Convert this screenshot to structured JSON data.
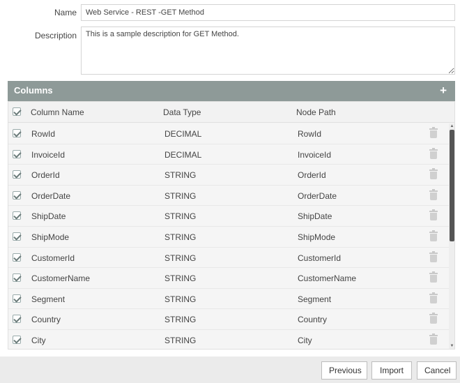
{
  "form": {
    "name_label": "Name",
    "name_value": "Web Service - REST -GET Method",
    "description_label": "Description",
    "description_value": "This is a sample description for GET Method."
  },
  "columns_panel": {
    "title": "Columns",
    "add_icon": "plus-icon"
  },
  "table": {
    "headers": {
      "column_name": "Column Name",
      "data_type": "Data Type",
      "node_path": "Node Path"
    },
    "rows": [
      {
        "name": "RowId",
        "type": "DECIMAL",
        "path": "RowId"
      },
      {
        "name": "InvoiceId",
        "type": "DECIMAL",
        "path": "InvoiceId"
      },
      {
        "name": "OrderId",
        "type": "STRING",
        "path": "OrderId"
      },
      {
        "name": "OrderDate",
        "type": "STRING",
        "path": "OrderDate"
      },
      {
        "name": "ShipDate",
        "type": "STRING",
        "path": "ShipDate"
      },
      {
        "name": "ShipMode",
        "type": "STRING",
        "path": "ShipMode"
      },
      {
        "name": "CustomerId",
        "type": "STRING",
        "path": "CustomerId"
      },
      {
        "name": "CustomerName",
        "type": "STRING",
        "path": "CustomerName"
      },
      {
        "name": "Segment",
        "type": "STRING",
        "path": "Segment"
      },
      {
        "name": "Country",
        "type": "STRING",
        "path": "Country"
      },
      {
        "name": "City",
        "type": "STRING",
        "path": "City"
      }
    ]
  },
  "footer": {
    "previous_label": "Previous",
    "import_label": "Import",
    "cancel_label": "Cancel"
  },
  "colors": {
    "panel_header": "#8e9a98",
    "footer_bg": "#ebebeb"
  }
}
